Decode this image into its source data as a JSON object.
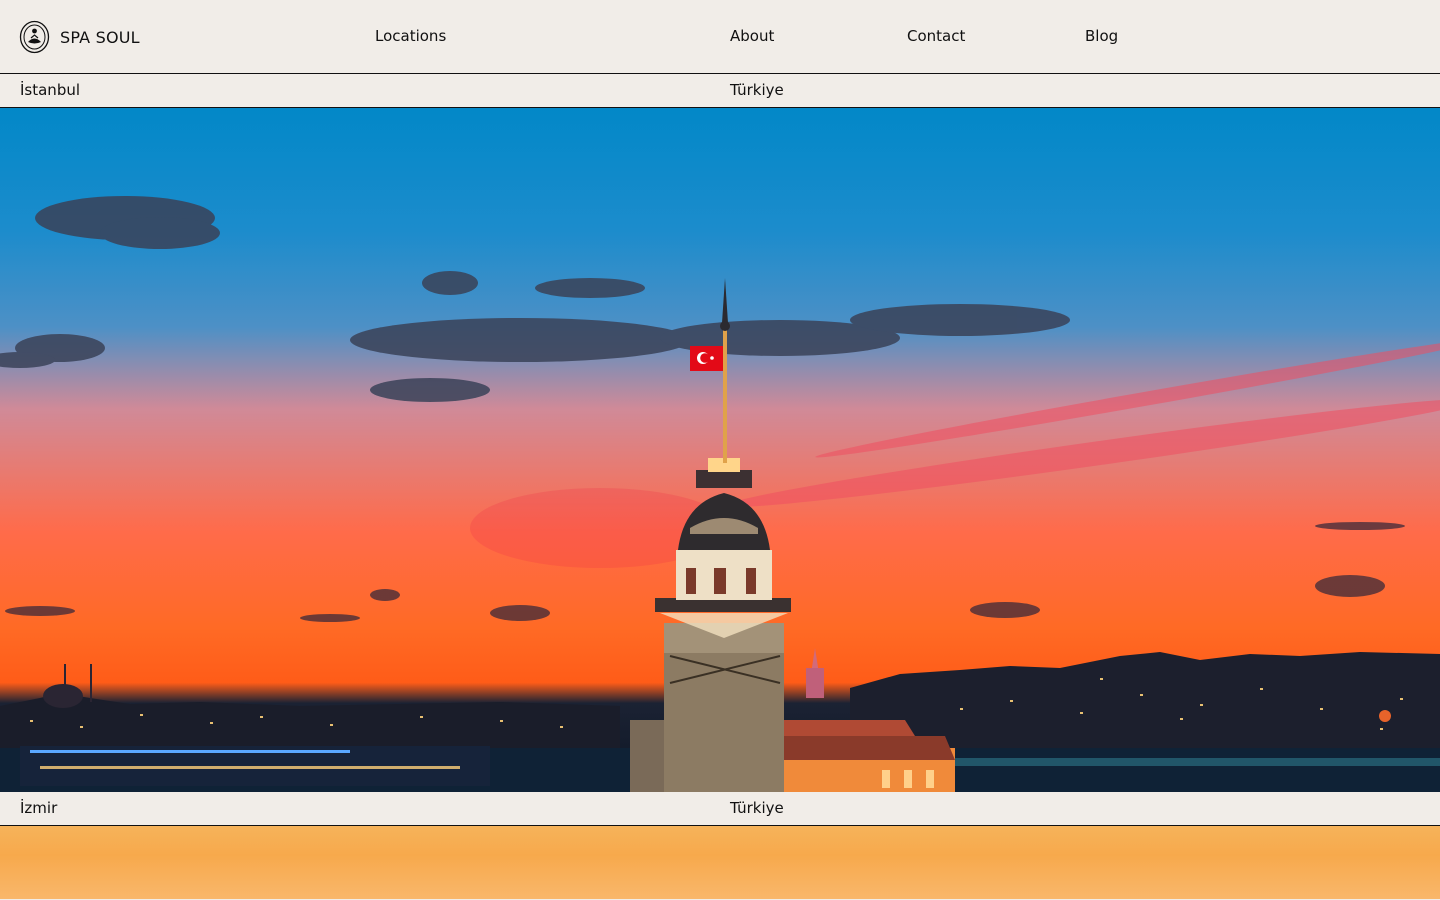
{
  "brand": {
    "name": "SPA SOUL",
    "icon": "meditation-logo-icon"
  },
  "nav": {
    "items": [
      {
        "label": "Locations"
      },
      {
        "label": "About"
      },
      {
        "label": "Contact"
      },
      {
        "label": "Blog"
      }
    ]
  },
  "locations": [
    {
      "city": "İstanbul",
      "country": "Türkiye",
      "image": "maidens-tower-sunset-photo"
    },
    {
      "city": "İzmir",
      "country": "Türkiye",
      "image": "izmir-sunset-photo"
    }
  ],
  "colors": {
    "background": "#f1ede8",
    "text": "#111111",
    "flag": "#e30a17"
  }
}
